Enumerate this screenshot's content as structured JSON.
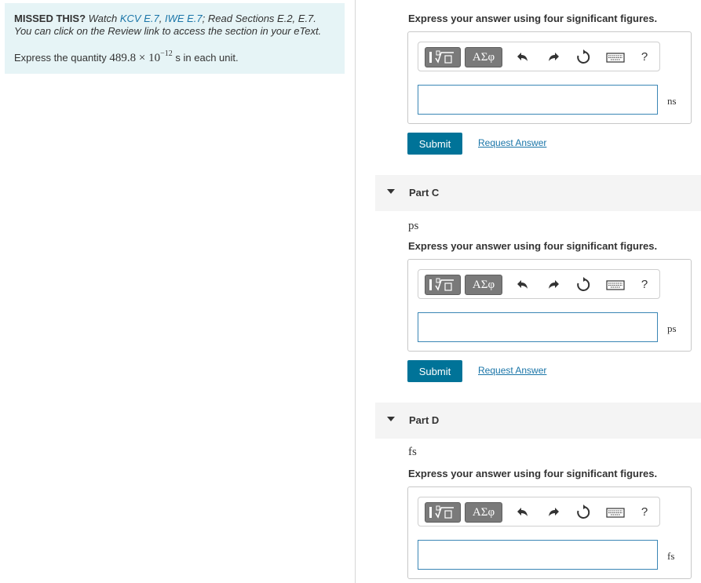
{
  "hint": {
    "missed": "MISSED THIS?",
    "watch": "Watch",
    "link1": "KCV E.7",
    "sep": ", ",
    "link2": "IWE E.7",
    "read": "; Read Sections E.2, E.7.",
    "line2": "You can click on the Review link to access the section in your eText.",
    "express_prefix": "Express the quantity",
    "quantity": "489.8 × 10",
    "exponent": "−12",
    "express_suffix": "s in each unit."
  },
  "toolbar": {
    "symbol_label": "ΑΣφ",
    "help_label": "?",
    "icons": [
      "templates-icon",
      "undo-icon",
      "redo-icon",
      "reset-icon",
      "keyboard-icon",
      "help-icon"
    ]
  },
  "instruction": "Express your answer using four significant figures.",
  "buttons": {
    "submit": "Submit",
    "request": "Request Answer"
  },
  "parts": [
    {
      "id": "B",
      "unit": "ns",
      "value": ""
    },
    {
      "id": "C",
      "title": "Part C",
      "unit": "ps",
      "value": ""
    },
    {
      "id": "D",
      "title": "Part D",
      "unit": "fs",
      "value": ""
    }
  ],
  "colors": {
    "hint_bg": "#e6f4f6",
    "link": "#1a75a8",
    "submit_bg": "#007398",
    "input_border": "#3a86b5"
  }
}
